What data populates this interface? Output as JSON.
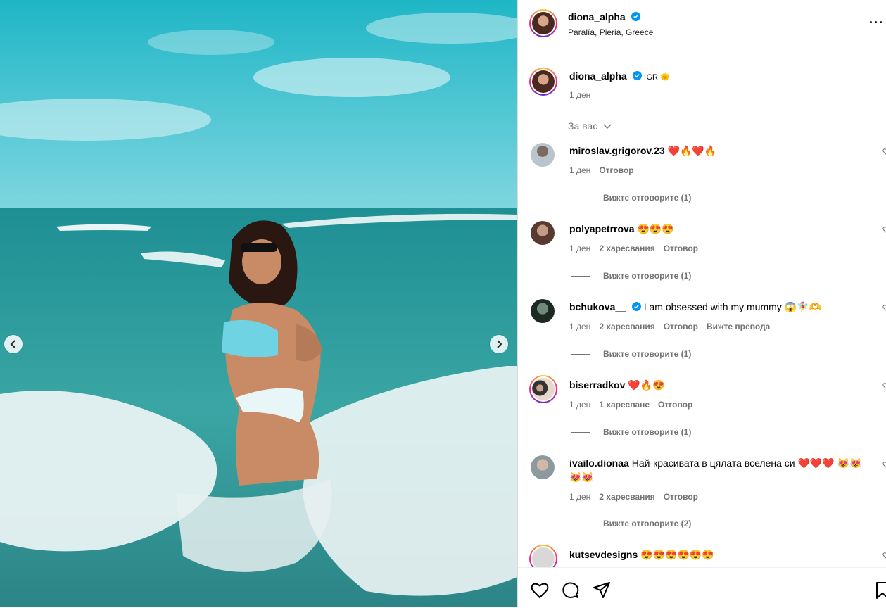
{
  "post": {
    "username": "diona_alpha",
    "location": "Paralía, Pieria, Greece",
    "caption_username": "diona_alpha",
    "caption_text": "GR 🌞",
    "caption_time": "1 ден"
  },
  "filter_label": "За вас",
  "comments": [
    {
      "username": "miroslav.grigorov.23",
      "text": "❤️🔥❤️🔥",
      "time": "1 ден",
      "likes": "",
      "reply": "Отговор",
      "translate": "",
      "view_replies": "Вижте отговорите (1)",
      "verified": false
    },
    {
      "username": "polyapetrrova",
      "text": "😍😍😍",
      "time": "1 ден",
      "likes": "2 харесвания",
      "reply": "Отговор",
      "translate": "",
      "view_replies": "Вижте отговорите (1)",
      "verified": false
    },
    {
      "username": "bchukova__",
      "text": "I am obsessed with my mummy 😱🧚‍♀️🫶",
      "time": "1 ден",
      "likes": "2 харесвания",
      "reply": "Отговор",
      "translate": "Вижте превода",
      "view_replies": "Вижте отговорите (1)",
      "verified": true
    },
    {
      "username": "biserradkov",
      "text": "❤️🔥😍",
      "time": "1 ден",
      "likes": "1 харесване",
      "reply": "Отговор",
      "translate": "",
      "view_replies": "Вижте отговорите (1)",
      "verified": false
    },
    {
      "username": "ivailo.dionaa",
      "text": "Най-красивата в цялата вселена си ❤️❤️❤️ 😻😻😻😻",
      "time": "1 ден",
      "likes": "2 харесвания",
      "reply": "Отговор",
      "translate": "",
      "view_replies": "Вижте отговорите (2)",
      "verified": false
    },
    {
      "username": "kutsevdesigns",
      "text": "😍😍😍😍😍😍",
      "time": "",
      "likes": "",
      "reply": "",
      "translate": "",
      "view_replies": "",
      "verified": false
    }
  ],
  "icons": {
    "like": "heart-icon",
    "comment": "comment-icon",
    "share": "share-icon",
    "save": "bookmark-icon",
    "prev": "chevron-left-icon",
    "next": "chevron-right-icon",
    "more": "more-options-icon"
  },
  "colors": {
    "verified": "#0095f6",
    "meta_text": "#737373",
    "border": "#dbdbdb"
  }
}
